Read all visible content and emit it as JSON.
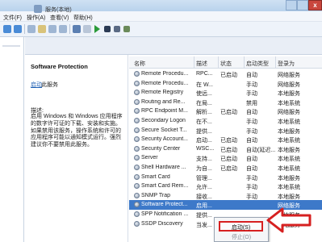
{
  "window": {
    "close_glyph": "x"
  },
  "menu": [
    "文件(F)",
    "操作(A)",
    "查看(V)",
    "帮助(H)"
  ],
  "header": {
    "title": "服务(本地)"
  },
  "detail": {
    "service_name": "Software Protection",
    "start_link": "启动",
    "start_suffix": "此服务",
    "desc_label": "描述:",
    "description": "启用 Windows 和 Windows 应用程序的数字许可证的下载、安装和实施。如果禁用该服务，操作系统和许可的应用程序可能以通知模式运行。强烈建议你不要禁用此服务。"
  },
  "columns": [
    "名称",
    "描述",
    "状态",
    "启动类型",
    "登录为"
  ],
  "rows": [
    {
      "name": "Remote Procedu...",
      "desc": "RPC...",
      "status": "已启动",
      "startup": "自动",
      "logon": "网络服务"
    },
    {
      "name": "Remote Procedu...",
      "desc": "在 W...",
      "status": "",
      "startup": "手动",
      "logon": "网络服务"
    },
    {
      "name": "Remote Registry",
      "desc": "使远...",
      "status": "",
      "startup": "手动",
      "logon": "本地服务"
    },
    {
      "name": "Routing and Re...",
      "desc": "在局...",
      "status": "",
      "startup": "禁用",
      "logon": "本地系统"
    },
    {
      "name": "RPC Endpoint M...",
      "desc": "解析...",
      "status": "已启动",
      "startup": "自动",
      "logon": "网络服务"
    },
    {
      "name": "Secondary Logon",
      "desc": "在不...",
      "status": "",
      "startup": "手动",
      "logon": "本地系统"
    },
    {
      "name": "Secure Socket T...",
      "desc": "提供...",
      "status": "",
      "startup": "手动",
      "logon": "本地服务"
    },
    {
      "name": "Security Account...",
      "desc": "启动...",
      "status": "已启动",
      "startup": "自动",
      "logon": "本地系统"
    },
    {
      "name": "Security Center",
      "desc": "WSC...",
      "status": "已启动",
      "startup": "自动(延迟...",
      "logon": "本地服务"
    },
    {
      "name": "Server",
      "desc": "支持...",
      "status": "已启动",
      "startup": "自动",
      "logon": "本地系统"
    },
    {
      "name": "Shell Hardware ...",
      "desc": "为自...",
      "status": "已启动",
      "startup": "自动",
      "logon": "本地系统"
    },
    {
      "name": "Smart Card",
      "desc": "管理...",
      "status": "",
      "startup": "手动",
      "logon": "本地服务"
    },
    {
      "name": "Smart Card Rem...",
      "desc": "允许...",
      "status": "",
      "startup": "手动",
      "logon": "本地系统"
    },
    {
      "name": "SNMP Trap",
      "desc": "接收...",
      "status": "",
      "startup": "手动",
      "logon": "本地服务"
    },
    {
      "name": "Software Protect...",
      "desc": "启用...",
      "status": "",
      "startup": "",
      "logon": "网络服务"
    },
    {
      "name": "SPP Notification ...",
      "desc": "提供...",
      "status": "",
      "startup": "",
      "logon": "本地服务"
    },
    {
      "name": "SSDP Discovery",
      "desc": "当发...",
      "status": "",
      "startup": "",
      "logon": "本地服务"
    }
  ],
  "context_menu": {
    "start": "启动(S)",
    "stop": "停止(O)"
  },
  "colors": {
    "selection": "#3d79c9",
    "highlight": "#d62020"
  }
}
